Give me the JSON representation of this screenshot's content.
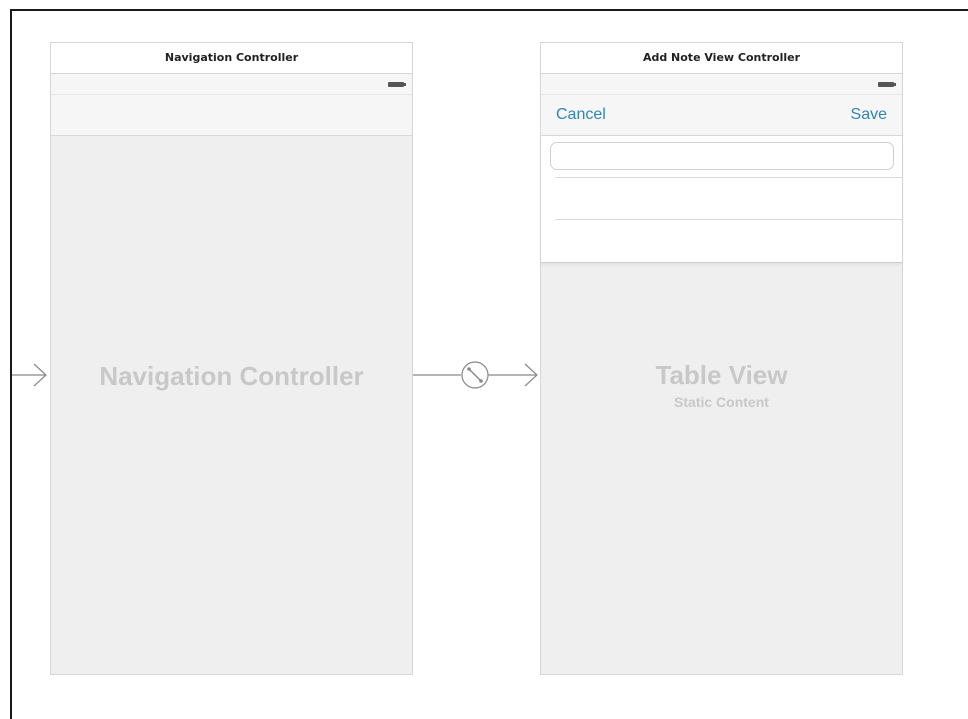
{
  "navigation_controller": {
    "scene_title": "Navigation Controller",
    "placeholder_title": "Navigation Controller"
  },
  "add_note_view_controller": {
    "scene_title": "Add Note View Controller",
    "nav_bar": {
      "cancel_label": "Cancel",
      "save_label": "Save"
    },
    "text_field": {
      "value": "",
      "placeholder": ""
    },
    "placeholder_title": "Table View",
    "placeholder_subtitle": "Static Content"
  },
  "segue": {
    "icon": "segue-relationship-icon"
  },
  "colors": {
    "bar_button_tint": "#2e86b5",
    "scene_background": "#efefef",
    "placeholder_text": "#c8c8c8",
    "arrow": "#888888"
  }
}
